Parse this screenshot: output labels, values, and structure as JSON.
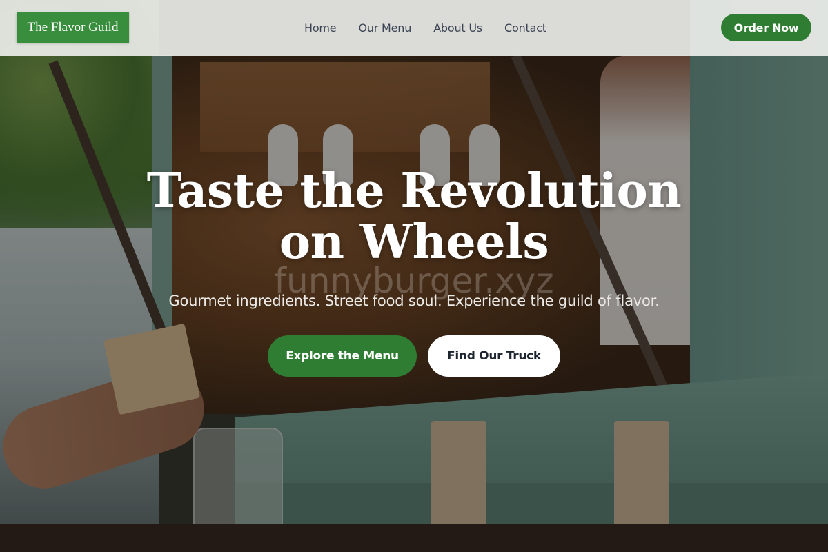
{
  "header": {
    "logo_text": "The Flavor Guild",
    "nav": [
      {
        "label": "Home"
      },
      {
        "label": "Our Menu"
      },
      {
        "label": "About Us"
      },
      {
        "label": "Contact"
      }
    ],
    "order_button": "Order Now"
  },
  "hero": {
    "title": "Taste the Revolution on Wheels",
    "watermark": "funnyburger.xyz",
    "subtitle": "Gourmet ingredients. Street food soul. Experience the guild of flavor.",
    "primary_cta": "Explore the Menu",
    "secondary_cta": "Find Our Truck"
  },
  "colors": {
    "brand_green": "#2e7d32",
    "logo_green": "#388e3c",
    "header_bg": "#f5f5f2",
    "nav_text": "#3b4452"
  },
  "background_image": "food-truck-serving-window"
}
